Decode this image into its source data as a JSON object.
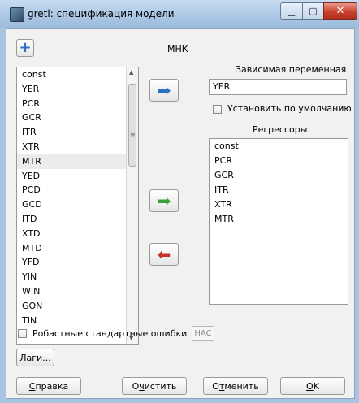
{
  "window": {
    "title": "gretl: спецификация модели",
    "minimize_glyph": "▁",
    "maximize_glyph": "▢",
    "close_glyph": "✕"
  },
  "header": {
    "add_glyph": "+",
    "method_label": "МНК"
  },
  "variables": {
    "items": [
      "const",
      "YER",
      "PCR",
      "GCR",
      "ITR",
      "XTR",
      "MTR",
      "YED",
      "PCD",
      "GCD",
      "ITD",
      "XTD",
      "MTD",
      "YFD",
      "YIN",
      "WIN",
      "GON",
      "TIN"
    ],
    "selected": "MTR"
  },
  "dependent": {
    "label": "Зависимая переменная",
    "value": "YER",
    "default_checkbox_label": "Установить по умолчанию",
    "default_checked": false
  },
  "regressors": {
    "label": "Регрессоры",
    "items": [
      "const",
      "PCR",
      "GCR",
      "ITR",
      "XTR",
      "MTR"
    ]
  },
  "robust": {
    "label": "Робастные стандартные ошибки",
    "checked": false,
    "hac_label": "HAC"
  },
  "buttons": {
    "lags": {
      "pre": "Лаги",
      "post": "..."
    },
    "help": {
      "u": "С",
      "rest": "правка"
    },
    "clear": {
      "pre": "О",
      "u": "ч",
      "rest": "истить"
    },
    "cancel": {
      "pre": "О",
      "u": "т",
      "rest": "менить"
    },
    "ok": {
      "u": "O",
      "rest": "K"
    }
  },
  "colors": {
    "arrow_blue": "#2f6fc0",
    "arrow_green": "#3aa23a",
    "arrow_red": "#c8312a"
  }
}
